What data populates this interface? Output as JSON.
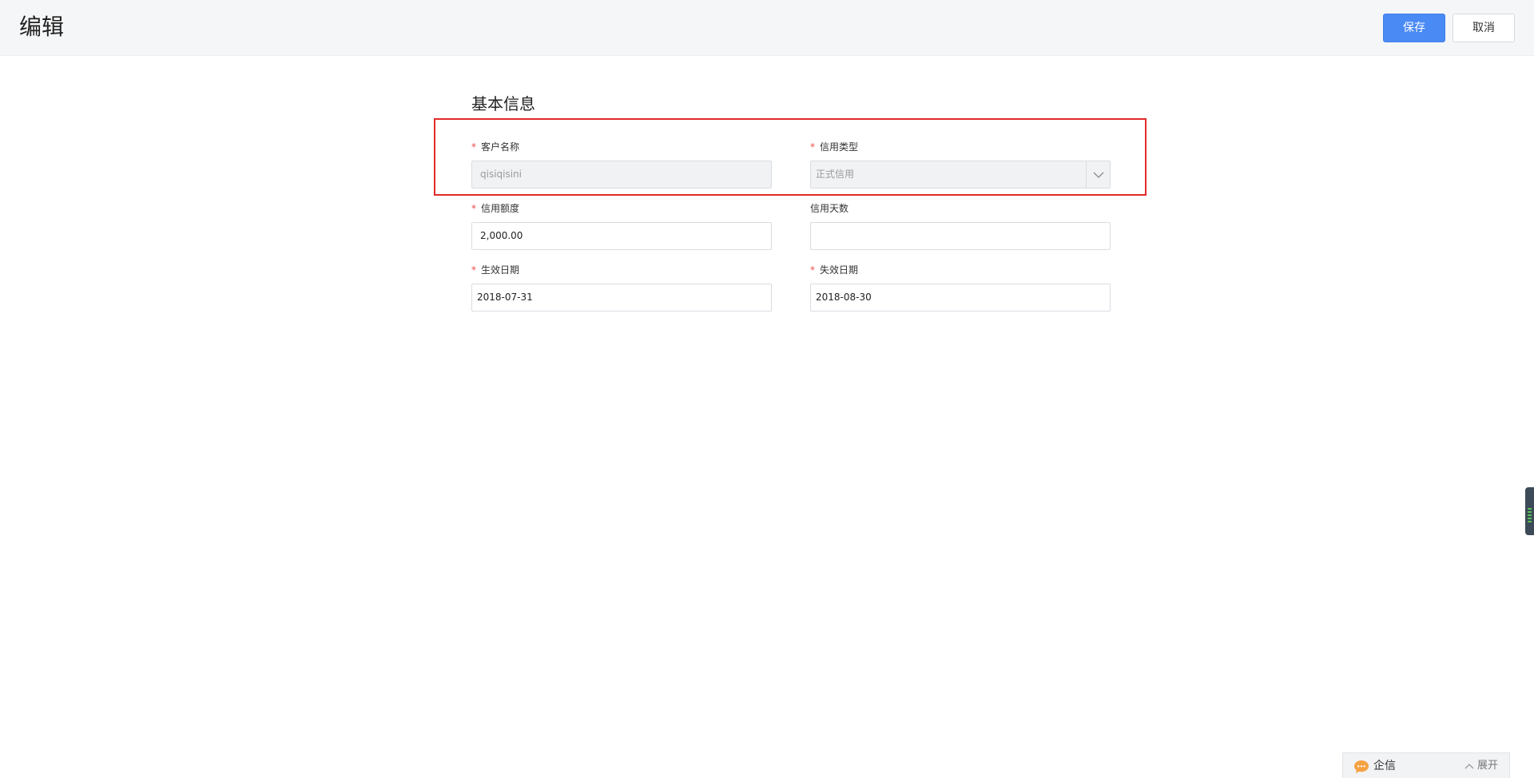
{
  "header": {
    "title": "编辑",
    "save_label": "保存",
    "cancel_label": "取消"
  },
  "section": {
    "title": "基本信息"
  },
  "form": {
    "customer_name": {
      "label": "客户名称",
      "required": "*",
      "value": "qisiqisini"
    },
    "credit_type": {
      "label": "信用类型",
      "required": "*",
      "value": "正式信用"
    },
    "credit_amount": {
      "label": "信用额度",
      "required": "*",
      "value": "2,000.00"
    },
    "credit_days": {
      "label": "信用天数",
      "value": ""
    },
    "effective_date": {
      "label": "生效日期",
      "required": "*",
      "value": "2018-07-31"
    },
    "expiry_date": {
      "label": "失效日期",
      "required": "*",
      "value": "2018-08-30"
    }
  },
  "chat": {
    "label": "企信",
    "toggle_label": "展开"
  },
  "colors": {
    "primary": "#4a8af4",
    "highlight_border": "#e22a2a",
    "required": "#f04a4a"
  },
  "icons": {
    "select_arrow": "chevron-down-icon",
    "chat": "chat-bubble-icon",
    "toggle": "chevron-up-icon"
  }
}
